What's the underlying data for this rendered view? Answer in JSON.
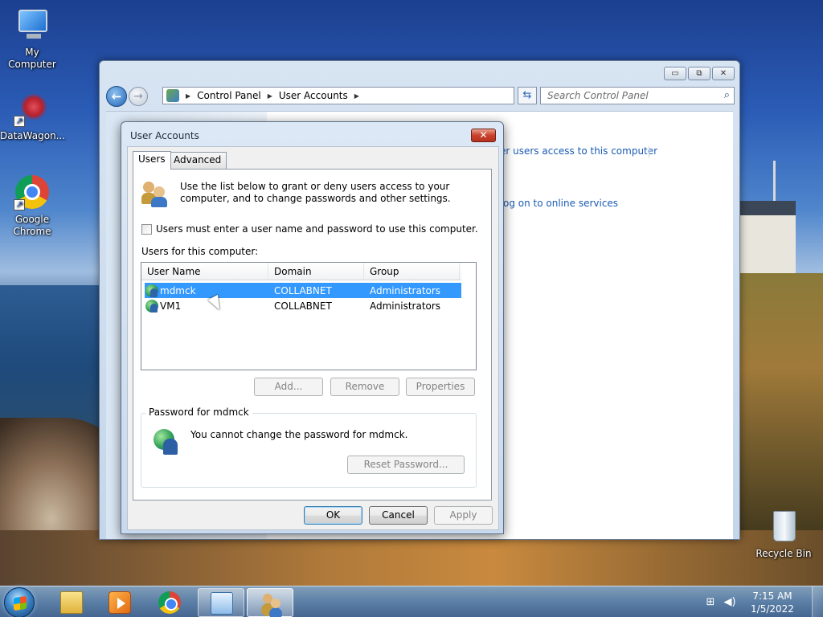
{
  "desktop": {
    "icons": [
      {
        "label": "My Computer",
        "icon": "computer-icon"
      },
      {
        "label": "DataWagon...",
        "icon": "datawagon-icon"
      },
      {
        "label": "Google Chrome",
        "icon": "chrome-icon"
      },
      {
        "label": "Recycle Bin",
        "icon": "recycle-bin-icon"
      }
    ]
  },
  "control_panel": {
    "breadcrumb": [
      "Control Panel",
      "User Accounts"
    ],
    "search_placeholder": "Search Control Panel",
    "links": {
      "manage_access": "er users access to this computer",
      "online_services": "og on to online services"
    },
    "window_controls": {
      "minimize": "▭",
      "maximize": "⧉",
      "close": "✕"
    }
  },
  "dialog": {
    "title": "User Accounts",
    "close_glyph": "✕",
    "tabs": [
      "Users",
      "Advanced"
    ],
    "active_tab": "Users",
    "intro_text": "Use the list below to grant or deny users access to your computer, and to change passwords and other settings.",
    "require_login_label": "Users must enter a user name and password to use this computer.",
    "require_login_checked": false,
    "users_label": "Users for this computer:",
    "columns": [
      "User Name",
      "Domain",
      "Group"
    ],
    "users": [
      {
        "name": "mdmck",
        "domain": "COLLABNET",
        "group": "Administrators",
        "selected": true
      },
      {
        "name": "VM1",
        "domain": "COLLABNET",
        "group": "Administrators",
        "selected": false
      }
    ],
    "list_buttons": {
      "add": "Add...",
      "remove": "Remove",
      "properties": "Properties"
    },
    "password_group": {
      "title": "Password for mdmck",
      "message": "You cannot change the password for mdmck.",
      "reset_button": "Reset Password..."
    },
    "footer_buttons": {
      "ok": "OK",
      "cancel": "Cancel",
      "apply": "Apply"
    }
  },
  "taskbar": {
    "items": [
      "file-explorer-icon",
      "media-player-icon",
      "chrome-icon",
      "control-panel-icon",
      "user-accounts-icon"
    ],
    "clock": {
      "time": "7:15 AM",
      "date": "1/5/2022"
    }
  },
  "colors": {
    "selection": "#3399ff",
    "link": "#1a5bb4",
    "close_red": "#c8412b"
  }
}
